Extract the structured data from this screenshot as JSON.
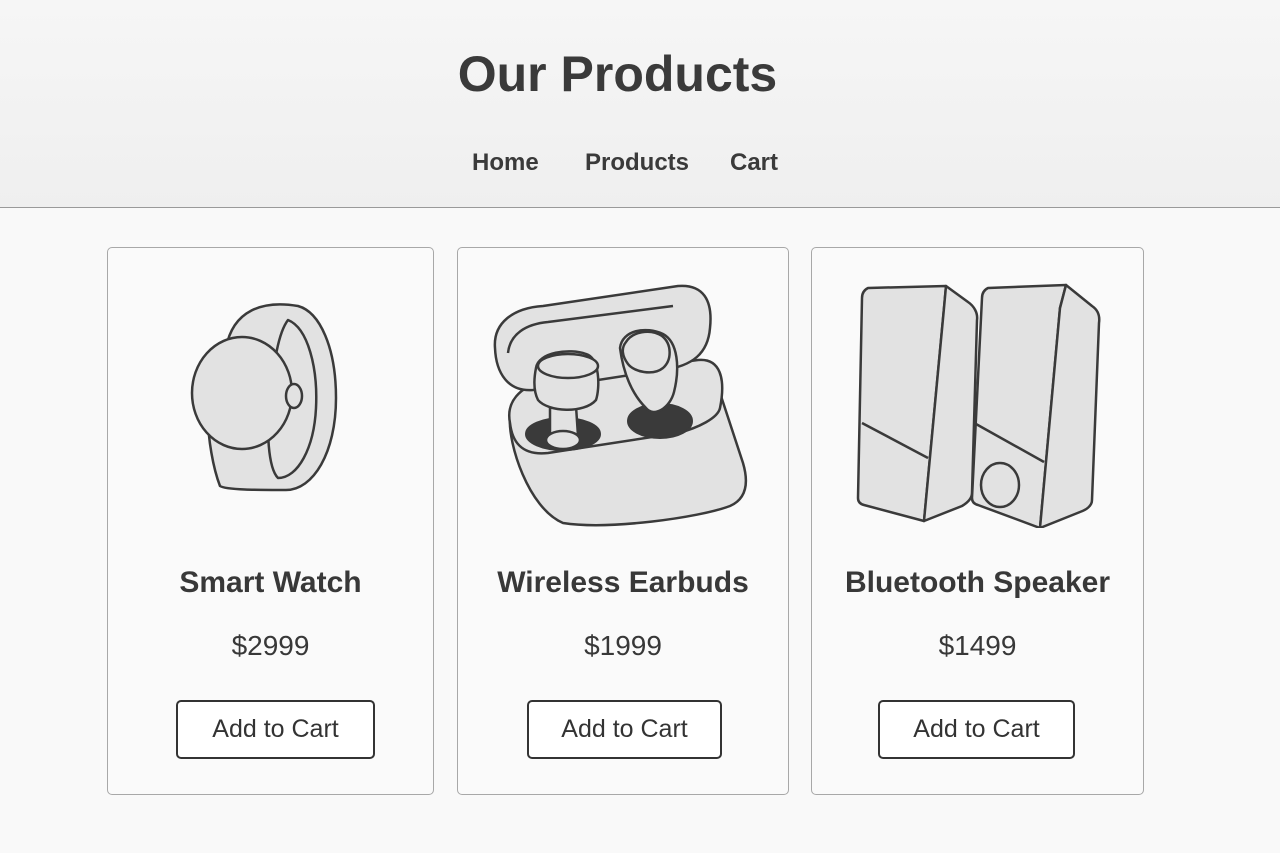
{
  "header": {
    "title": "Our Products",
    "nav": [
      "Home",
      "Products",
      "Cart"
    ]
  },
  "products": [
    {
      "name": "Smart Watch",
      "price": "$2999",
      "button": "Add to Cart",
      "icon": "smart-watch-icon"
    },
    {
      "name": "Wireless Earbuds",
      "price": "$1999",
      "button": "Add to Cart",
      "icon": "wireless-earbuds-icon"
    },
    {
      "name": "Bluetooth Speaker",
      "price": "$1499",
      "button": "Add to Cart",
      "icon": "bluetooth-speaker-icon"
    }
  ],
  "colors": {
    "background": "#f9f9f9",
    "header_background": "#f0f0f0",
    "text": "#333333",
    "card_border": "#a8a8a8",
    "illustration_fill": "#e2e2e2",
    "illustration_dark": "#3a3a3a"
  }
}
